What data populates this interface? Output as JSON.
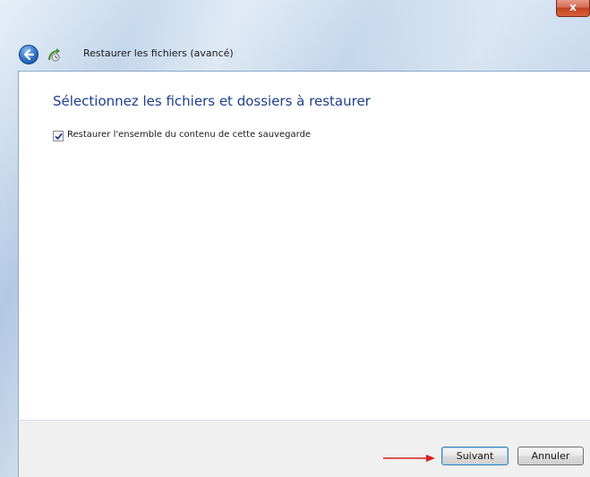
{
  "window": {
    "close_glyph": "x",
    "nav_title": "Restaurer les fichiers (avancé)"
  },
  "icons": {
    "back": "back-arrow-icon",
    "app": "restore-files-icon",
    "checkbox": "checkmark-icon"
  },
  "main": {
    "heading": "Sélectionnez les fichiers et dossiers à restaurer",
    "restore_all": {
      "label": "Restaurer l'ensemble du contenu de cette sauvegarde",
      "checked": true
    }
  },
  "footer": {
    "next_label": "Suivant",
    "cancel_label": "Annuler"
  },
  "colors": {
    "heading": "#1e3f8a",
    "close_button": "#c2401f",
    "annotation_arrow": "#d42020"
  }
}
